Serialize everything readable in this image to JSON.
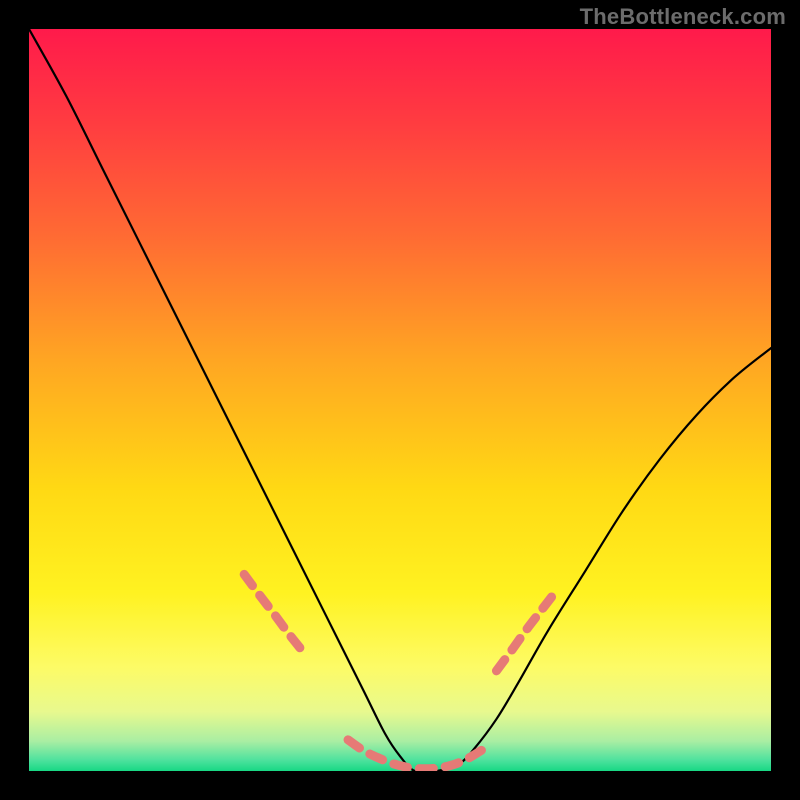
{
  "watermark": "TheBottleneck.com",
  "chart_data": {
    "type": "line",
    "title": "",
    "xlabel": "",
    "ylabel": "",
    "xlim": [
      0,
      100
    ],
    "ylim": [
      0,
      100
    ],
    "grid": false,
    "legend": false,
    "curve": {
      "name": "bottleneck-curve",
      "x": [
        0,
        5,
        10,
        15,
        20,
        25,
        30,
        35,
        40,
        45,
        48,
        50,
        52,
        55,
        58,
        60,
        63,
        66,
        70,
        75,
        80,
        85,
        90,
        95,
        100
      ],
      "y": [
        100,
        91,
        81,
        71,
        61,
        51,
        41,
        31,
        21,
        11,
        5,
        2,
        0,
        0,
        1,
        3,
        7,
        12,
        19,
        27,
        35,
        42,
        48,
        53,
        57
      ]
    },
    "highlight_segments": [
      {
        "x": [
          29,
          31,
          33,
          35,
          37
        ],
        "y": [
          26.5,
          23.8,
          21.2,
          18.5,
          16
        ]
      },
      {
        "x": [
          43,
          45,
          47,
          49,
          51,
          53,
          55,
          57,
          59,
          61
        ],
        "y": [
          4.2,
          2.8,
          1.8,
          1.0,
          0.5,
          0.3,
          0.4,
          0.8,
          1.6,
          2.8
        ]
      },
      {
        "x": [
          63,
          65,
          67,
          69,
          71
        ],
        "y": [
          13.5,
          16.2,
          19,
          21.6,
          24.2
        ]
      }
    ],
    "background_gradient_stops": [
      {
        "pos": 0.0,
        "color": "#ff1a4b"
      },
      {
        "pos": 0.12,
        "color": "#ff3a41"
      },
      {
        "pos": 0.28,
        "color": "#ff6b33"
      },
      {
        "pos": 0.45,
        "color": "#ffa722"
      },
      {
        "pos": 0.62,
        "color": "#ffd914"
      },
      {
        "pos": 0.76,
        "color": "#fff221"
      },
      {
        "pos": 0.86,
        "color": "#fdfb66"
      },
      {
        "pos": 0.92,
        "color": "#e8f98e"
      },
      {
        "pos": 0.96,
        "color": "#a9eea3"
      },
      {
        "pos": 0.985,
        "color": "#4fe29e"
      },
      {
        "pos": 1.0,
        "color": "#18d884"
      }
    ],
    "colors": {
      "curve_stroke": "#000000",
      "highlight_stroke": "#e67a76",
      "frame": "#000000"
    }
  }
}
